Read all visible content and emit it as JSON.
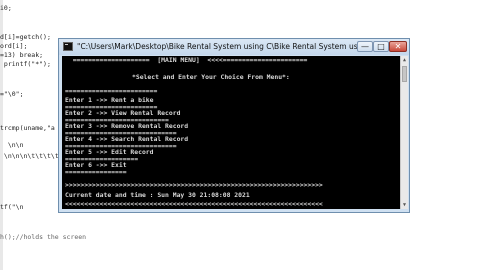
{
  "editor": {
    "lines": [
      "i0;",
      "d[i]=getch();",
      "ord[i];",
      "=13) break;",
      " printf(\"*\");",
      "=\"\\0\";",
      "trcmp(uname,\"a",
      "  \\n\\n",
      " \\n\\n\\n\\t\\t\\t\\t",
      "tf(\"\\n",
      "h();//holds the screen"
    ]
  },
  "window": {
    "title": "\"C:\\Users\\Mark\\Desktop\\Bike Rental System using C\\Bike Rental System using C...",
    "minimize_label": "—",
    "maximize_label": "□",
    "close_label": "✕"
  },
  "console": {
    "header": "  ====================  [MAIN MENU]  <<<<======================",
    "prompt": "*Select and Enter Your Choice From Menu*:",
    "divider": "========================",
    "options": [
      "Enter 1 ->> Rent a bike",
      "Enter 2 ->> View Rental Record",
      "Enter 3 ->> Remove Rental Record",
      "Enter 4 ->> Search Rental Record",
      "Enter 5 ->> Edit Record",
      "Enter 6 ->> Exit"
    ],
    "option_underlines": [
      "========================",
      "===========================",
      "=============================",
      "=============================",
      "===================",
      "================"
    ],
    "footer_bar": ">>>>>>>>>>>>>>>>>>>>>>>>>>>>>>>>>>>>>>>>>>>>>>>>>>>>>>>>>>>>>>>>>>>",
    "datetime": "Current date and time : Sun May 30 21:08:08 2021",
    "bottom_bar": "<<<<<<<<<<<<<<<<<<<<<<<<<<<<<<<<<<<<<<<<<<<<<<<<<<<<<<<<<<<<<<<<<<<"
  }
}
